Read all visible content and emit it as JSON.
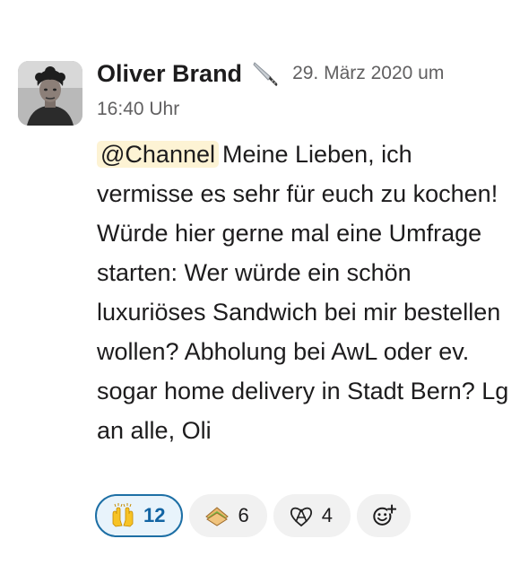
{
  "message": {
    "author": "Oliver Brand",
    "status_icon": "knife-icon",
    "timestamp_line1": "29. März 2020 um",
    "timestamp_line2": "16:40 Uhr",
    "mention": "@Channel",
    "text": "Meine Lieben, ich vermisse es sehr für euch zu kochen! Würde hier gerne mal eine Umfrage starten: Wer würde ein schön luxuriöses Sandwich bei mir bestellen wollen? Abholung bei AwL oder ev. sogar home delivery in Stadt Bern? Lg an alle, Oli"
  },
  "reactions": [
    {
      "icon": "raised-hands-emoji",
      "count": "12",
      "active": true
    },
    {
      "icon": "sandwich-emoji",
      "count": "6",
      "active": false
    },
    {
      "icon": "anarchy-heart-emoji",
      "count": "4",
      "active": false
    }
  ],
  "colors": {
    "mention_bg": "#fdf3d4",
    "active_reaction_border": "#1d6fa5",
    "active_reaction_bg": "#e8f3fb",
    "secondary_text": "#616061"
  }
}
